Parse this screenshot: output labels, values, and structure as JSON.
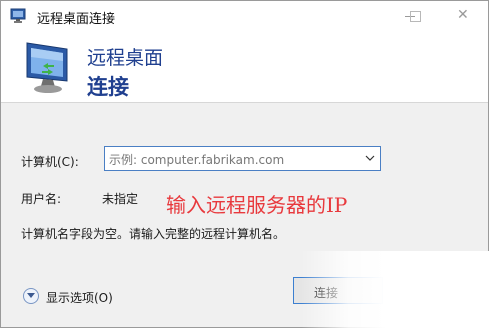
{
  "window": {
    "title": "远程桌面连接",
    "app_icon": "remote-desktop-icon",
    "controls": {
      "minimize_icon": "minimize-icon",
      "maximize_icon": "maximize-icon",
      "close_icon": "close-icon",
      "close_glyph": "✕"
    }
  },
  "header": {
    "icon": "monitor-icon",
    "line1": "远程桌面",
    "line2": "连接",
    "title_color": "#1f3f8f"
  },
  "form": {
    "computer_label": "计算机(C):",
    "computer_placeholder": "示例: computer.fabrikam.com",
    "username_label": "用户名:",
    "username_value": "未指定",
    "info_text": "计算机名字段为空。请输入完整的远程计算机名。"
  },
  "annotation": {
    "text": "输入远程服务器的IP",
    "color": "#e8393d"
  },
  "footer": {
    "options_label": "显示选项(O)",
    "options_icon": "chevron-down-circle-icon",
    "connect_label": "连接"
  },
  "colors": {
    "accent": "#3c7fd0",
    "window_bg": "#f0f0f0"
  }
}
